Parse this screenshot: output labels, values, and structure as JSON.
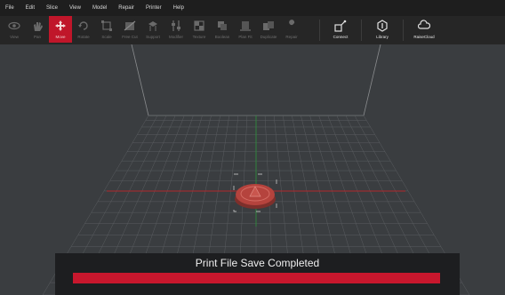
{
  "menu": [
    "File",
    "Edit",
    "Slice",
    "View",
    "Model",
    "Repair",
    "Printer",
    "Help"
  ],
  "toolbar": {
    "tools": [
      {
        "label": "View",
        "icon": "eye-icon"
      },
      {
        "label": "Pan",
        "icon": "hand-icon"
      },
      {
        "label": "Move",
        "icon": "move-icon",
        "active": true
      },
      {
        "label": "Rotate",
        "icon": "rotate-icon"
      },
      {
        "label": "Scale",
        "icon": "scale-icon"
      },
      {
        "label": "Free Cut",
        "icon": "cut-icon"
      },
      {
        "label": "Support",
        "icon": "support-icon"
      },
      {
        "label": "Modifier",
        "icon": "modifier-icon"
      },
      {
        "label": "Texture",
        "icon": "texture-icon"
      },
      {
        "label": "Boolean",
        "icon": "boolean-icon"
      },
      {
        "label": "Plan Fit",
        "icon": "plan-fit-icon"
      },
      {
        "label": "Duplicate",
        "icon": "duplicate-icon"
      },
      {
        "label": "Repair",
        "icon": "wrench-icon"
      }
    ],
    "right_tools": [
      {
        "label": "Connect",
        "icon": "connect-icon"
      },
      {
        "label": "Library",
        "icon": "library-icon"
      },
      {
        "label": "RaiseCloud",
        "icon": "cloud-icon"
      }
    ]
  },
  "status": {
    "message": "Print File Save Completed",
    "progress": 1.0
  },
  "colors": {
    "accent": "#c0162a",
    "grid": "#5a5d60",
    "axis_x": "#b3262b",
    "axis_y": "#2e8b3c",
    "model": "#b5433d"
  }
}
